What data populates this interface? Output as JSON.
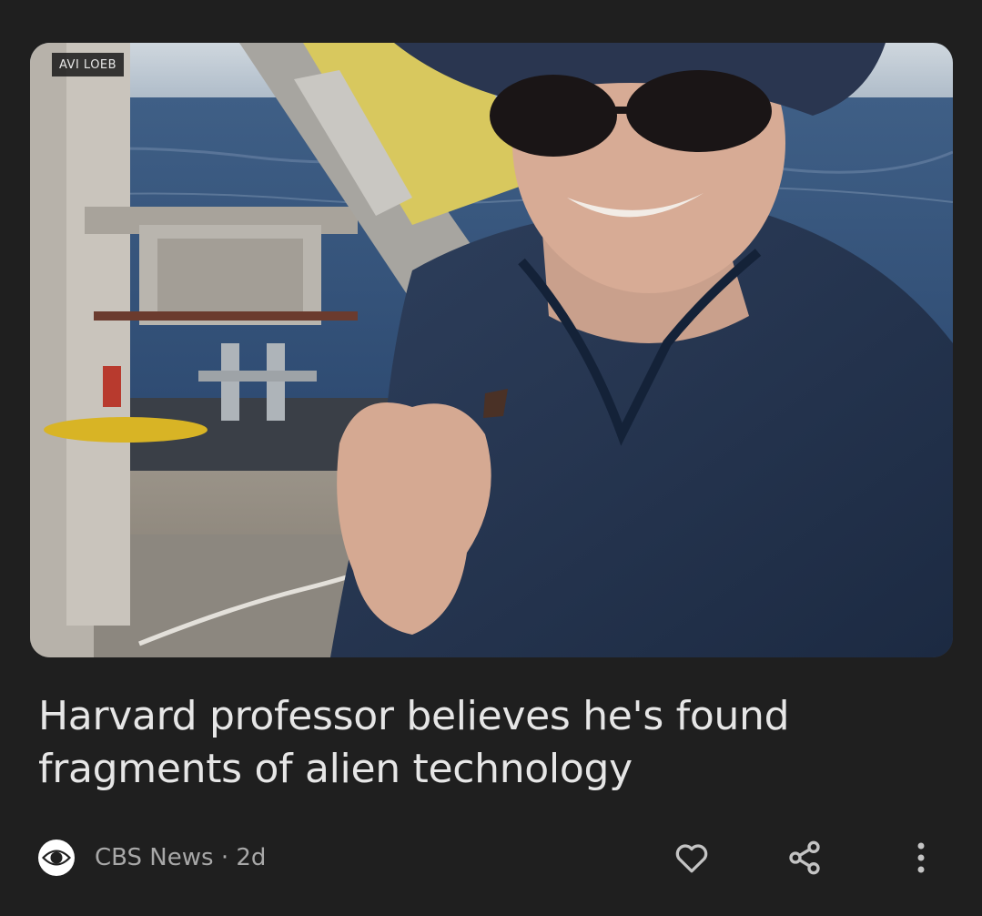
{
  "article": {
    "photo_credit": "AVI LOEB",
    "headline": "Harvard professor believes he's found fragments of alien technology",
    "source_name": "CBS News",
    "separator": " · ",
    "age": "2d"
  },
  "icons": {
    "source_logo": "cbs-eye-icon",
    "like": "heart-outline-icon",
    "share": "share-icon",
    "more": "more-vertical-icon"
  },
  "colors": {
    "background": "#1f1f1f",
    "headline_text": "#e6e6e6",
    "meta_text": "#a8a8a8",
    "icon": "#c4c4c4"
  }
}
